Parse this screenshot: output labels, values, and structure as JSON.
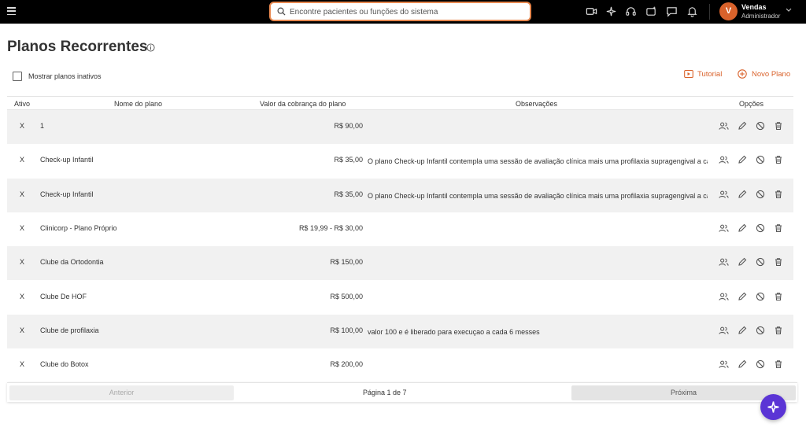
{
  "topbar": {
    "search_placeholder": "Encontre pacientes ou funções do sistema",
    "user": {
      "initial": "V",
      "name": "Vendas",
      "role": "Administrador"
    }
  },
  "header": {
    "title": "Planos Recorrentes",
    "show_inactive_label": "Mostrar planos inativos",
    "tutorial_label": "Tutorial",
    "new_plan_label": "Novo Plano"
  },
  "table": {
    "columns": [
      "Ativo",
      "Nome do plano",
      "Valor da cobrança do plano",
      "Observações",
      "Opções"
    ],
    "rows": [
      {
        "active": "X",
        "name": "1",
        "value": "R$ 90,00",
        "obs": ""
      },
      {
        "active": "X",
        "name": "Check-up Infantil",
        "value": "R$ 35,00",
        "obs": "O plano Check-up Infantil contempla uma sessão de avaliação clínica mais uma profilaxia supragengival a ca"
      },
      {
        "active": "X",
        "name": "Check-up Infantil",
        "value": "R$ 35,00",
        "obs": "O plano Check-up Infantil contempla uma sessão de avaliação clínica mais uma profilaxia supragengival a ca"
      },
      {
        "active": "X",
        "name": "Clinicorp - Plano Próprio",
        "value": "R$ 19,99 - R$ 30,00",
        "obs": ""
      },
      {
        "active": "X",
        "name": "Clube da Ortodontia",
        "value": "R$ 150,00",
        "obs": ""
      },
      {
        "active": "X",
        "name": "Clube De HOF",
        "value": "R$ 500,00",
        "obs": ""
      },
      {
        "active": "X",
        "name": "Clube de profilaxia",
        "value": "R$ 100,00",
        "obs": "valor 100 e é liberado para execuçao a cada 6 messes"
      },
      {
        "active": "X",
        "name": "Clube do Botox",
        "value": "R$ 200,00",
        "obs": ""
      }
    ]
  },
  "pagination": {
    "prev_label": "Anterior",
    "page_info": "Página 1 de 7",
    "next_label": "Próxima"
  },
  "colors": {
    "accent": "#d9622b",
    "fab": "#5b35d5",
    "topbar": "#000000"
  }
}
